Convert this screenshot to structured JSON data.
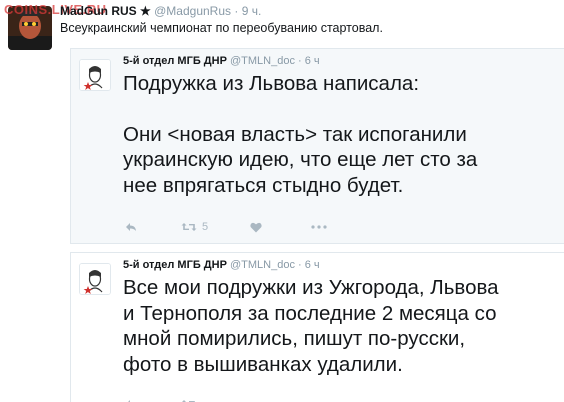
{
  "watermark": "COINS.LIVE.RU",
  "top_tweet": {
    "name": "MadGun RUS",
    "name_suffix": "★",
    "handle": "@MadgunRus",
    "time": "9 ч.",
    "text": "Всеукраинский чемпионат по переобуванию стартовал."
  },
  "quoted": [
    {
      "name": "5-й отдел МГБ ДНР",
      "handle": "@TMLN_doc",
      "time": "6 ч",
      "line1": "Подружка из Львова написала:",
      "line2": "Они <новая власть> так испоганили",
      "line3": "украинскую идею, что еще лет сто за",
      "line4": "нее впрягаться стыдно будет.",
      "retweet_count": "5"
    },
    {
      "name": "5-й отдел МГБ ДНР",
      "handle": "@TMLN_doc",
      "time": "6 ч",
      "line1": "Все мои подружки из Ужгорода, Львова",
      "line2": "и Тернополя за последние 2 месяца со",
      "line3": "мной помирились, пишут по-русски,",
      "line4": "фото в вышиванках удалили."
    }
  ],
  "icons": [
    "reply-icon",
    "retweet-icon",
    "like-icon",
    "more-icon"
  ],
  "colors": {
    "text": "#14171a",
    "meta": "#8899a6",
    "icon": "#aab8c2",
    "border": "#e1e8ed",
    "quote_bg": "#f5f8fa"
  }
}
